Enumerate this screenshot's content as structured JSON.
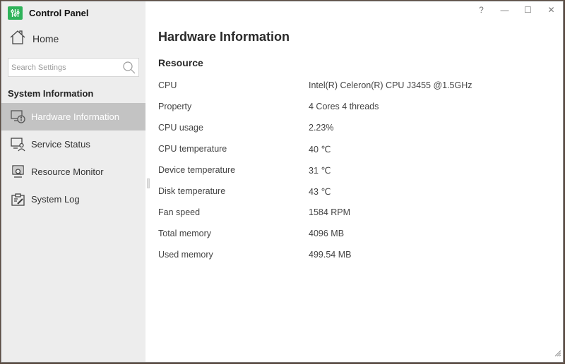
{
  "window": {
    "app_title": "Control Panel",
    "brand_color": "#2fb35a",
    "titlebar_buttons": [
      {
        "name": "help",
        "glyph": "?"
      },
      {
        "name": "minimize",
        "glyph": "—"
      },
      {
        "name": "maximize",
        "glyph": "☐"
      },
      {
        "name": "close",
        "glyph": "✕"
      }
    ]
  },
  "sidebar": {
    "home_label": "Home",
    "search": {
      "placeholder": "Search Settings",
      "value": ""
    },
    "section_title": "System Information",
    "items": [
      {
        "label": "Hardware Information",
        "icon": "monitor-info-icon",
        "active": true
      },
      {
        "label": "Service Status",
        "icon": "monitor-user-icon",
        "active": false
      },
      {
        "label": "Resource Monitor",
        "icon": "monitor-search-icon",
        "active": false
      },
      {
        "label": "System Log",
        "icon": "clipboard-edit-icon",
        "active": false
      }
    ]
  },
  "main": {
    "title": "Hardware Information",
    "group_title": "Resource",
    "rows": [
      {
        "label": "CPU",
        "value": "Intel(R) Celeron(R) CPU J3455 @1.5GHz"
      },
      {
        "label": "Property",
        "value": "4 Cores 4 threads"
      },
      {
        "label": "CPU usage",
        "value": "2.23%"
      },
      {
        "label": "CPU temperature",
        "value": "40 ℃"
      },
      {
        "label": "Device temperature",
        "value": "31 ℃"
      },
      {
        "label": "Disk temperature",
        "value": "43 ℃"
      },
      {
        "label": "Fan speed",
        "value": "1584 RPM"
      },
      {
        "label": "Total memory",
        "value": "4096 MB"
      },
      {
        "label": "Used memory",
        "value": "499.54 MB"
      }
    ]
  }
}
